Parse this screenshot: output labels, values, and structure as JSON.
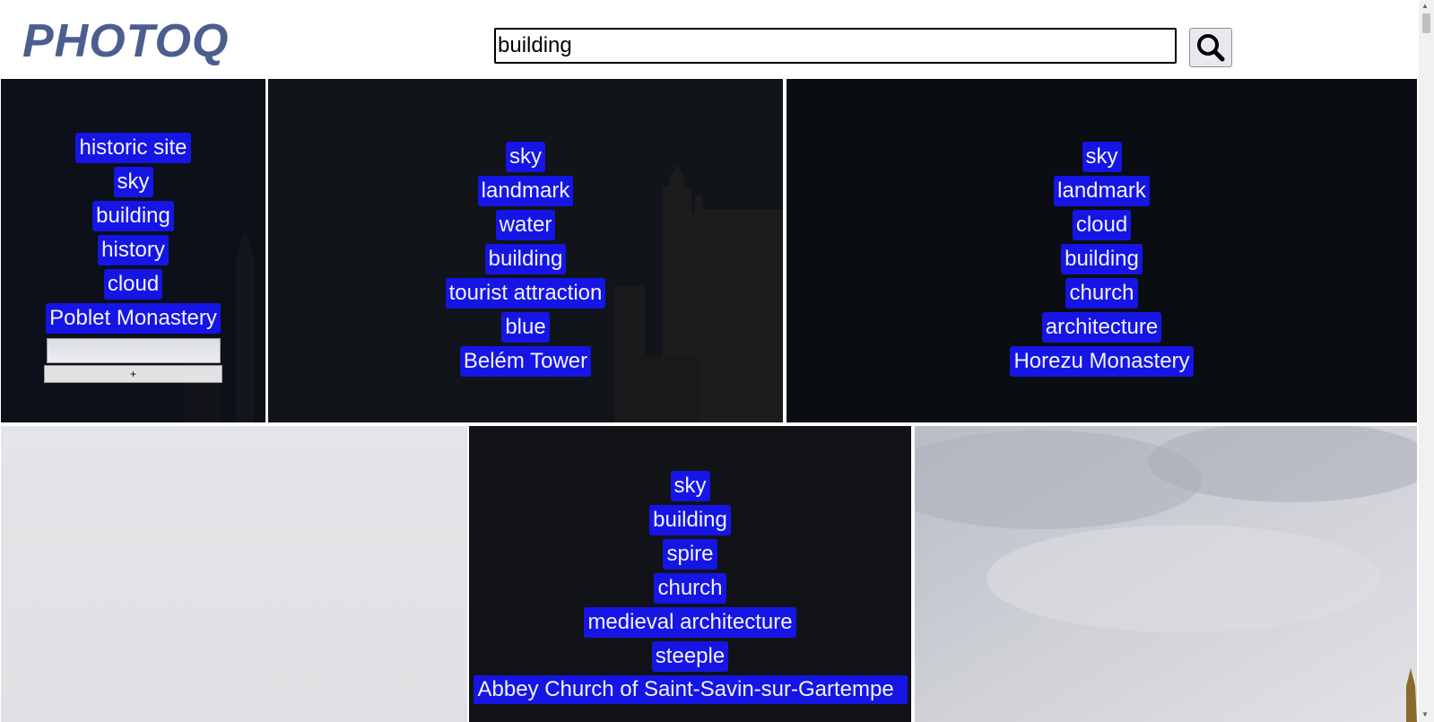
{
  "app": {
    "logo": "PHOTOQ"
  },
  "search": {
    "value": "building"
  },
  "icons": {
    "search": "magnifier-icon"
  },
  "colors": {
    "tag_bg": "#1515e6",
    "logo": "#4c5e8e"
  },
  "gallery": {
    "row1": [
      {
        "tags": [
          "historic site",
          "sky",
          "building",
          "history",
          "cloud",
          "Poblet Monastery"
        ],
        "add_button": "+"
      },
      {
        "tags": [
          "sky",
          "landmark",
          "water",
          "building",
          "tourist attraction",
          "blue",
          "Belém Tower"
        ]
      },
      {
        "tags": [
          "sky",
          "landmark",
          "cloud",
          "building",
          "church",
          "architecture",
          "Horezu Monastery"
        ]
      }
    ],
    "row2": [
      {
        "tags": []
      },
      {
        "tags": [
          "sky",
          "building",
          "spire",
          "church",
          "medieval architecture",
          "steeple",
          "Abbey Church of Saint-Savin-sur-Gartempe"
        ]
      },
      {
        "tags": []
      }
    ]
  }
}
